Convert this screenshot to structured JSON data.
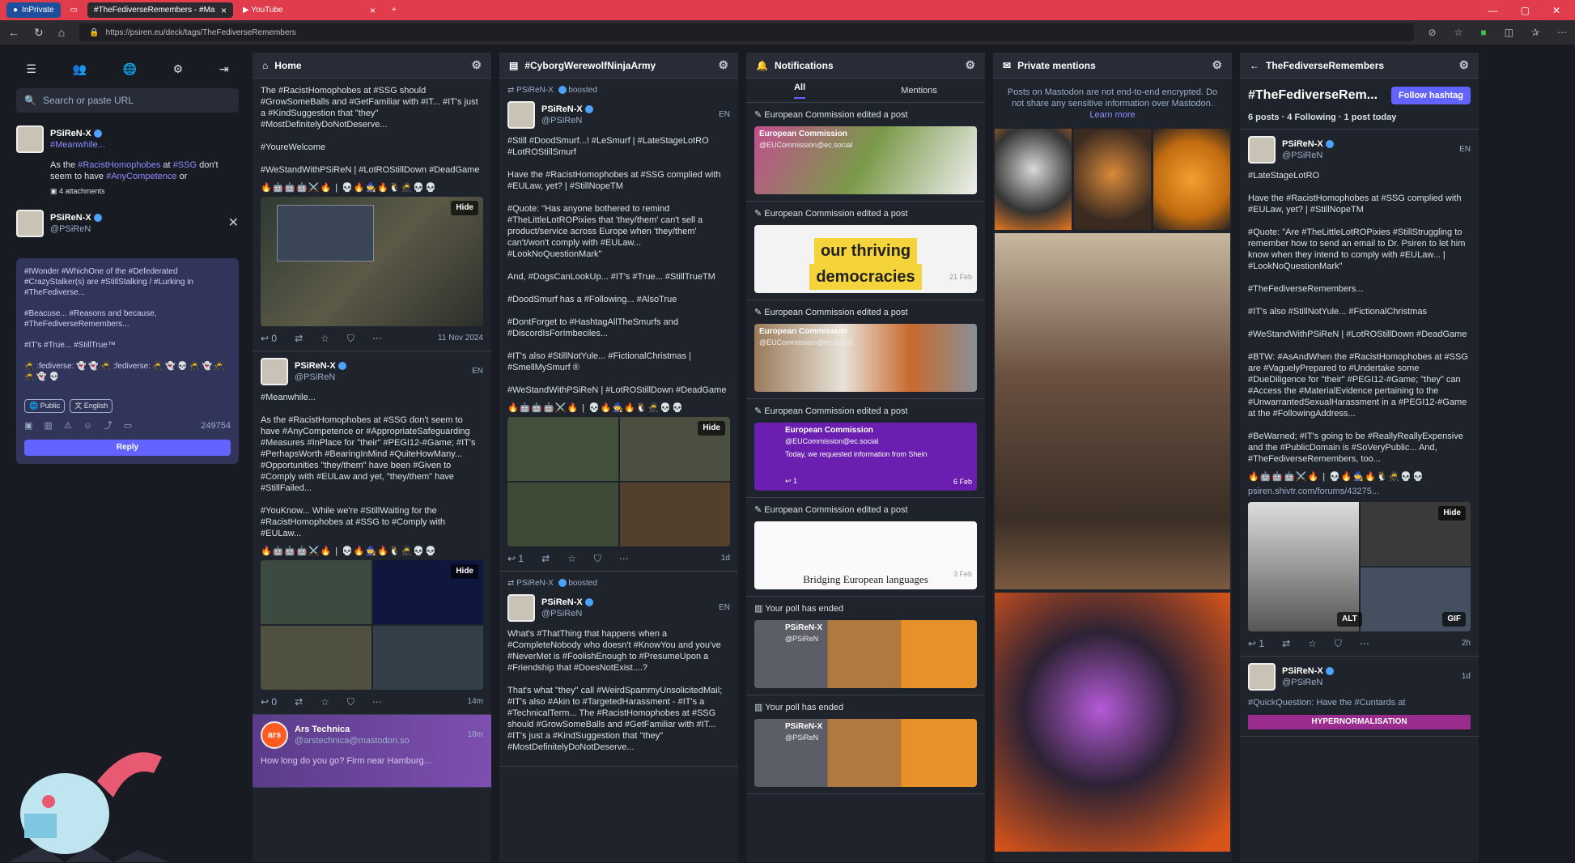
{
  "browser": {
    "tabs": [
      {
        "label": "InPrivate"
      },
      {
        "label": "#TheFediverseRemembers - #Ma"
      },
      {
        "label": "YouTube"
      }
    ],
    "url": "https://psiren.eu/deck/tags/TheFediverseRemembers"
  },
  "sidebar": {
    "search_placeholder": "Search or paste URL",
    "account": {
      "name": "PSiReN-X",
      "handle": "#Meanwhile...",
      "snippet_a": "As the ",
      "tag1": "#RacistHomophobes",
      "snippet_b": " at ",
      "tag2": "#SSG",
      "snippet_c": " don't seem to have ",
      "tag3": "#AnyCompetence",
      "snippet_d": " or",
      "attachments": "4 attachments"
    },
    "reply_to": {
      "name": "PSiReN-X",
      "handle": "@PSiReN"
    },
    "compose_text": "#IWonder #WhichOne of the #Defederated #CrazyStalker(s) are #StillStalking / #Lurking in #TheFediverse...\n\n#Beacuse... #Reasons and because, #TheFediverseRemembers...\n\n#IT's #True... #StillTrue™\n\n🥷 :fediverse: 👻 👻 🥷 :fediverse: 🥷 👻 💀 🥷 👻 🥷\n🥷 👻 💀",
    "visibility": "Public",
    "language": "English",
    "char_count": "249754",
    "reply_label": "Reply"
  },
  "home": {
    "title": "Home",
    "post1_text": "The #RacistHomophobes at #SSG should #GrowSomeBalls and #GetFamiliar with #IT... #IT's just a #KindSuggestion that \"they\" #MostDefinitelyDoNotDeserve...\n\n#YoureWelcome\n\n#WeStandWithPSiReN | #LotROStillDown #DeadGame",
    "post1_emojis": "🔥🤖🤖🤖⚔️🔥 | 💀🔥🧙🔥🐧🥷💀💀",
    "hide": "Hide",
    "post1_time": "11 Nov 2024",
    "post2_name": "PSiReN-X",
    "post2_handle": "@PSiReN",
    "post2_meta": "EN",
    "post2_text": "#Meanwhile...\n\nAs the #RacistHomophobes at #SSG don't seem to have #AnyCompetence or #AppropriateSafeguarding #Measures #InPlace for \"their\" #PEGI12-#Game; #IT's #PerhapsWorth #BearingInMind #QuiteHowMany... #Opportunities \"they/them\" have been #Given to #Comply with #EULaw and yet, \"they/them\" have #StillFailed...\n\n#YouKnow... While we're #StillWaiting for the #RacistHomophobes at #SSG to #Comply with #EULaw...",
    "post2_emojis": "🔥🤖🤖🤖⚔️🔥 | 💀🔥🧙🔥🐧🥷💀💀",
    "post2_time": "14m",
    "post3_name": "Ars Technica",
    "post3_handle": "@arstechnica@mastodon.so",
    "post3_text": "How long do you go? Firm near Hamburg...",
    "post3_time": "18m",
    "post3_logo": "ars",
    "counts": {
      "replies": "0"
    }
  },
  "cyber": {
    "title": "#CyborgWerewolfNinjaArmy",
    "boosted_a": "PSiReN-X",
    "boosted_b": "boosted",
    "post1_name": "PSiReN-X",
    "post1_handle": "@PSiReN",
    "post1_meta": "EN",
    "post1_text": "#Still #DoodSmurf...! #LeSmurf | #LateStageLotRO #LotROStillSmurf\n\nHave the #RacistHomophobes at #SSG complied with #EULaw, yet? | #StillNopeTM\n\n#Quote: \"Has anyone bothered to remind #TheLittleLotROPixies that 'they/them' can't sell a product/service across Europe when 'they/them' can't/won't comply with #EULaw... #LookNoQuestionMark\"\n\nAnd, #DogsCanLookUp... #IT's #True... #StillTrueTM\n\n#DoodSmurf has a #Following... #AlsoTrue\n\n#DontForget to #HashtagAllTheSmurfs and #DiscordIsForImbeciles...\n\n#IT's also #StillNotYule... #FictionalChristmas | #SmellMySmurf ®\n\n#WeStandWithPSiReN | #LotROStillDown #DeadGame",
    "post1_emojis": "🔥🤖🤖🤖⚔️🔥 | 💀🔥🧙🔥🐧🥷💀💀",
    "hide": "Hide",
    "post1_count": "1",
    "post1_time": "1d",
    "boost2_a": "PSiReN-X",
    "boost2_b": "boosted",
    "post2_name": "PSiReN-X",
    "post2_handle": "@PSiReN",
    "post2_meta": "EN",
    "post2_text": "What's #ThatThing that happens when a #CompleteNobody who doesn't #KnowYou and you've #NeverMet is #FoolishEnough to #PresumeUpon a #Friendship that #DoesNotExist....?\n\nThat's what \"they\" call #WeirdSpammyUnsolicitedMail; #IT's also #Akin to #TargetedHarassment - #IT's a #TechnicalTerm... The #RacistHomophobes at #SSG should #GrowSomeBalls and #GetFamiliar with #IT... #IT's just a #KindSuggestion that \"they\" #MostDefinitelyDoNotDeserve..."
  },
  "notifications": {
    "title": "Notifications",
    "tab_all": "All",
    "tab_mentions": "Mentions",
    "edited": "European Commission edited a post",
    "ec_name": "European Commission",
    "ec_handle": "@EUCommission@ec.social",
    "img2_text1": "our thriving",
    "img2_text2": "democracies",
    "img2_date": "21 Feb",
    "img4_text": "Today, we requested information from Shein",
    "img4_time": "6 Feb",
    "img4_count": "1",
    "img5_text": "Bridging European languages",
    "img5_date": "3 Feb",
    "poll": "Your poll has ended",
    "poll_name": "PSiReN-X",
    "poll_handle": "@PSiReN"
  },
  "mentions": {
    "title": "Private mentions",
    "notice": "Posts on Mastodon are not end-to-end encrypted. Do not share any sensitive information over Mastodon.",
    "learn": "Learn more"
  },
  "tag": {
    "title": "TheFediverseRemembers",
    "hashtag": "#TheFediverseRem...",
    "follow": "Follow hashtag",
    "stats": "6 posts · 4 Following · 1 post today",
    "post_name": "PSiReN-X",
    "post_handle": "@PSiReN",
    "post_meta": "EN",
    "post_text": "#LateStageLotRO\n\nHave the #RacistHomophobes at #SSG complied with #EULaw, yet? | #StillNopeTM\n\n#Quote: \"Are #TheLittleLotROPixies #StillStruggling to remember how to send an email to Dr. Psiren to let him know when they intend to comply with #EULaw... | #LookNoQuestionMark\"\n\n#TheFediverseRemembers...\n\n#IT's also #StillNotYule... #FictionalChristmas\n\n#WeStandWithPSiReN | #LotROStillDown #DeadGame\n\n#BTW: #AsAndWhen the #RacistHomophobes at #SSG are #VaguelyPrepared to #Undertake some #DueDiligence for \"their\" #PEGI12-#Game; \"they\" can #Access the #MaterialEvidence pertaining to the #UnwarrantedSexualHarassment in a #PEGI12-#Game at the #FollowingAddress...\n\n#BeWarned; #IT's going to be #ReallyReallyExpensive and the #PublicDomain is #SoVeryPublic... And, #TheFediverseRemembers, too...",
    "post_emojis": "🔥🤖🤖🤖⚔️🔥 | 💀🔥🧙🔥🐧🥷💀💀",
    "link": "psiren.shivtr.com/forums/43275...",
    "hide": "Hide",
    "alt": "ALT",
    "gif": "GIF",
    "post_count": "1",
    "post_time": "2h",
    "post2_name": "PSiReN-X",
    "post2_handle": "@PSiReN",
    "post2_text": "#QuickQuestion: Have the #Cuntards at",
    "post2_time": "1d",
    "post2_banner": "HYPERNORMALISATION"
  }
}
